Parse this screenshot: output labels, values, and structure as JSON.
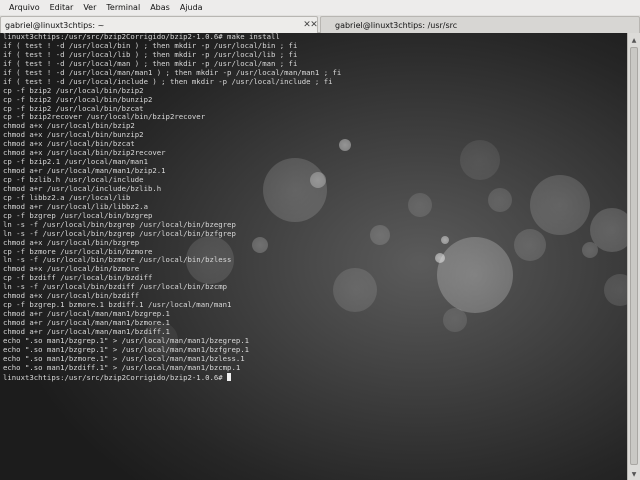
{
  "menubar": {
    "items": [
      {
        "label": "Arquivo"
      },
      {
        "label": "Editar"
      },
      {
        "label": "Ver"
      },
      {
        "label": "Terminal"
      },
      {
        "label": "Abas"
      },
      {
        "label": "Ajuda"
      }
    ]
  },
  "tabs": [
    {
      "label": "gabriel@linuxt3chtips: ~",
      "close_glyph": "✕"
    },
    {
      "label": "gabriel@linuxt3chtips: /usr/src",
      "close_glyph": "✕"
    }
  ],
  "terminal": {
    "lines": [
      "linuxt3chtips:/usr/src/bzip2Corrigido/bzip2-1.0.6# make install",
      "if ( test ! -d /usr/local/bin ) ; then mkdir -p /usr/local/bin ; fi",
      "if ( test ! -d /usr/local/lib ) ; then mkdir -p /usr/local/lib ; fi",
      "if ( test ! -d /usr/local/man ) ; then mkdir -p /usr/local/man ; fi",
      "if ( test ! -d /usr/local/man/man1 ) ; then mkdir -p /usr/local/man/man1 ; fi",
      "if ( test ! -d /usr/local/include ) ; then mkdir -p /usr/local/include ; fi",
      "cp -f bzip2 /usr/local/bin/bzip2",
      "cp -f bzip2 /usr/local/bin/bunzip2",
      "cp -f bzip2 /usr/local/bin/bzcat",
      "cp -f bzip2recover /usr/local/bin/bzip2recover",
      "chmod a+x /usr/local/bin/bzip2",
      "chmod a+x /usr/local/bin/bunzip2",
      "chmod a+x /usr/local/bin/bzcat",
      "chmod a+x /usr/local/bin/bzip2recover",
      "cp -f bzip2.1 /usr/local/man/man1",
      "chmod a+r /usr/local/man/man1/bzip2.1",
      "cp -f bzlib.h /usr/local/include",
      "chmod a+r /usr/local/include/bzlib.h",
      "cp -f libbz2.a /usr/local/lib",
      "chmod a+r /usr/local/lib/libbz2.a",
      "cp -f bzgrep /usr/local/bin/bzgrep",
      "ln -s -f /usr/local/bin/bzgrep /usr/local/bin/bzegrep",
      "ln -s -f /usr/local/bin/bzgrep /usr/local/bin/bzfgrep",
      "chmod a+x /usr/local/bin/bzgrep",
      "cp -f bzmore /usr/local/bin/bzmore",
      "ln -s -f /usr/local/bin/bzmore /usr/local/bin/bzless",
      "chmod a+x /usr/local/bin/bzmore",
      "cp -f bzdiff /usr/local/bin/bzdiff",
      "ln -s -f /usr/local/bin/bzdiff /usr/local/bin/bzcmp",
      "chmod a+x /usr/local/bin/bzdiff",
      "cp -f bzgrep.1 bzmore.1 bzdiff.1 /usr/local/man/man1",
      "chmod a+r /usr/local/man/man1/bzgrep.1",
      "chmod a+r /usr/local/man/man1/bzmore.1",
      "chmod a+r /usr/local/man/man1/bzdiff.1",
      "echo \".so man1/bzgrep.1\" > /usr/local/man/man1/bzegrep.1",
      "echo \".so man1/bzgrep.1\" > /usr/local/man/man1/bzfgrep.1",
      "echo \".so man1/bzmore.1\" > /usr/local/man/man1/bzless.1",
      "echo \".so man1/bzdiff.1\" > /usr/local/man/man1/bzcmp.1"
    ],
    "prompt": "linuxt3chtips:/usr/src/bzip2Corrigido/bzip2-1.0.6# "
  },
  "scrollbar": {
    "up_glyph": "▲",
    "down_glyph": "▼"
  },
  "colors": {
    "terminal_text": "#d9d9d9",
    "terminal_bg": "#2a2a2a",
    "chrome_bg": "#edecea"
  }
}
